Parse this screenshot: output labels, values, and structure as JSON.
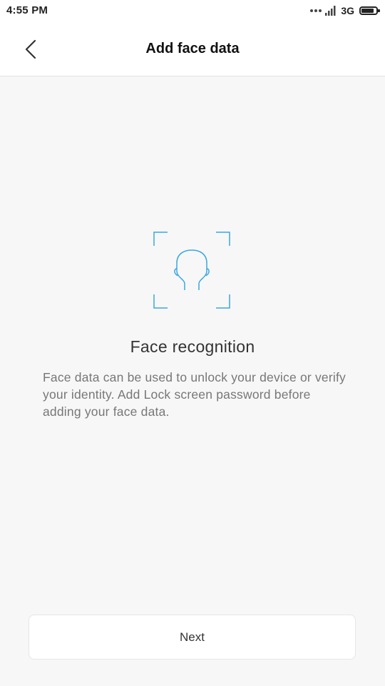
{
  "status_bar": {
    "time": "4:55 PM",
    "network_type": "3G",
    "battery_level": 0.85,
    "icons": [
      "more-dots-icon",
      "signal-icon",
      "battery-icon"
    ]
  },
  "header": {
    "back_icon": "chevron-left-icon",
    "title": "Add face data"
  },
  "content": {
    "illustration_icon": "face-scan-icon",
    "accent_color": "#3aa7e0",
    "title": "Face recognition",
    "description": "Face data can be used to unlock your device or verify your identity. Add Lock screen password before adding your face data."
  },
  "footer": {
    "next_label": "Next"
  }
}
